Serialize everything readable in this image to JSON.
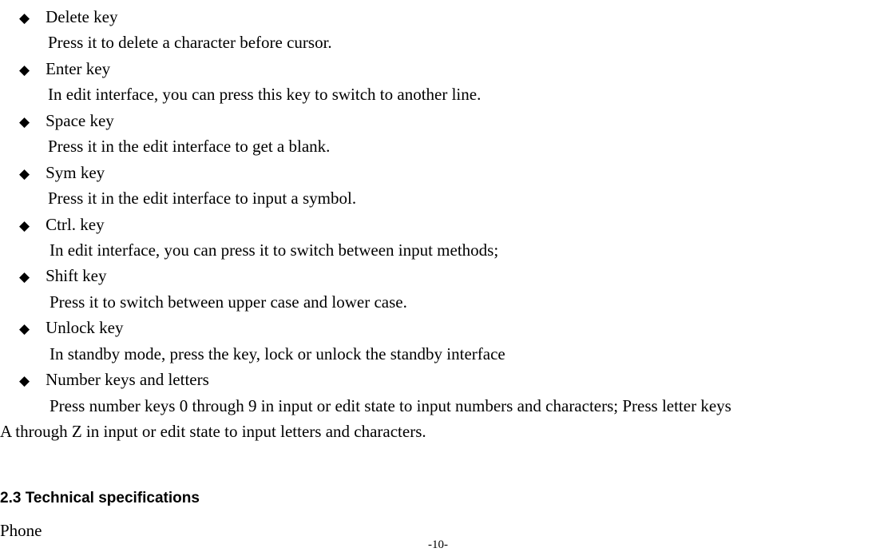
{
  "bullets": [
    {
      "title": "Delete key",
      "desc": "Press it to delete a character before cursor.",
      "indent": false
    },
    {
      "title": "Enter key",
      "desc": "In edit interface, you can press this key to switch to another line.",
      "indent": false
    },
    {
      "title": "Space key",
      "desc": "Press it in the edit interface to get a blank.",
      "indent": false
    },
    {
      "title": "Sym key",
      "desc": "Press it in the edit interface to input a symbol.",
      "indent": false
    },
    {
      "title": "Ctrl. key",
      "desc": "In edit interface, you can press it to switch between input methods;",
      "indent": true
    },
    {
      "title": "Shift key",
      "desc": "Press it to switch between upper case and lower case.",
      "indent": true
    },
    {
      "title": "Unlock key",
      "desc": "In standby mode, press the key, lock or unlock the standby interface",
      "indent": true
    },
    {
      "title": "Number keys and letters",
      "desc": "Press number keys 0 through 9 in input or edit state to input numbers and characters; Press letter keys",
      "indent": true
    }
  ],
  "continuation": "A through Z in input or edit state to input letters and characters.",
  "section_heading": "2.3  Technical specifications",
  "phone_label": "Phone",
  "page_number": "-10-",
  "bullet_glyph": "◆"
}
